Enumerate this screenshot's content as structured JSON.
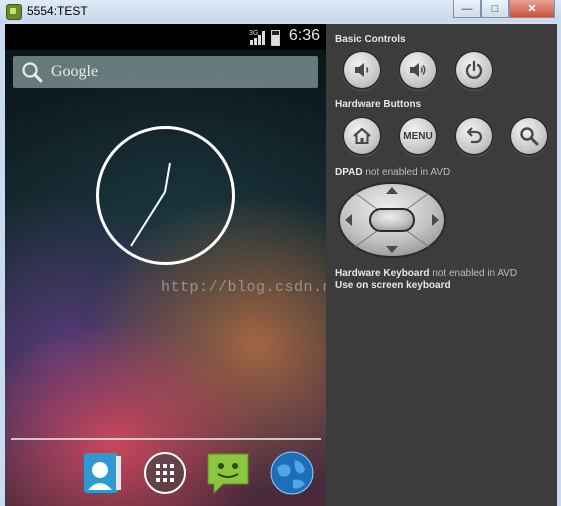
{
  "window": {
    "title": "5554:TEST",
    "minimize_label": "—",
    "maximize_label": "□",
    "close_label": "✕"
  },
  "phone": {
    "status": {
      "time": "6:36",
      "network": "3G"
    },
    "search": {
      "placeholder": "Google"
    },
    "clock": {
      "type": "analog"
    },
    "dock": [
      {
        "name": "contacts"
      },
      {
        "name": "apps"
      },
      {
        "name": "messaging"
      },
      {
        "name": "browser"
      }
    ],
    "watermark": "http://blog.csdn.net/movel"
  },
  "controls": {
    "basic_controls_heading": "Basic Controls",
    "basic_buttons": [
      "volume-down",
      "volume-up",
      "power"
    ],
    "hardware_buttons_heading": "Hardware Buttons",
    "hardware_buttons": [
      "home",
      "menu",
      "back",
      "search"
    ],
    "menu_label": "MENU",
    "dpad_heading": "DPAD",
    "dpad_note": "not enabled in AVD",
    "keyboard_heading": "Hardware Keyboard",
    "keyboard_note": "not enabled in AVD",
    "onscreen_keyboard": "Use on screen keyboard"
  }
}
